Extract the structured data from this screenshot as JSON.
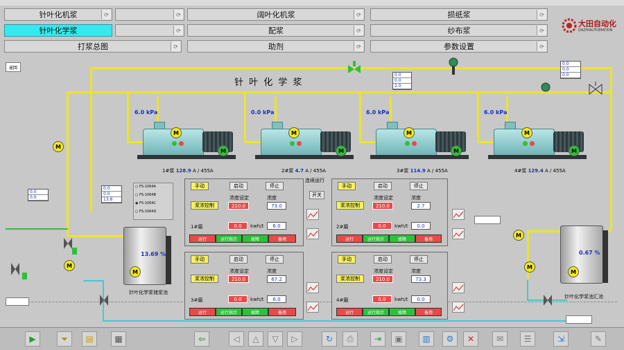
{
  "nav": {
    "row1": [
      "针叶化机浆",
      "阔叶化机浆",
      "损纸浆"
    ],
    "row2": [
      "针叶化学浆",
      "配浆",
      "纱布浆"
    ],
    "row3": [
      "打浆总图",
      "助剂",
      "参数设置"
    ]
  },
  "logo": {
    "name": "大田自动化",
    "sub": "DAZHIAUTOMATION"
  },
  "page_tag": "返回",
  "title": "针 叶 化 学 浆",
  "pumps": [
    {
      "label": "1#浆",
      "current": "128.9",
      "unit": "A / 455A",
      "pressure": "6.0"
    },
    {
      "label": "2#浆",
      "current": "4.7",
      "unit": "A / 455A",
      "pressure": "0.0"
    },
    {
      "label": "3#浆",
      "current": "114.9",
      "unit": "A / 455A",
      "pressure": "6.0"
    },
    {
      "label": "4#浆",
      "current": "129.4",
      "unit": "A / 455A",
      "pressure": "6.0"
    }
  ],
  "pressure_unit": "kPa",
  "top_table": [
    "0.0",
    "0.0",
    "2.0"
  ],
  "right_table": [
    "0.0",
    "0.0",
    "0.0"
  ],
  "left_table": [
    "0.0",
    "0.0"
  ],
  "mid_table": [
    "0.0",
    "0.0",
    "13.8"
  ],
  "radio_options": [
    "FS-1064A",
    "FS-1064B",
    "FS-1064C",
    "FS-1064D"
  ],
  "side_label": "连续运行",
  "side_btn": "开关",
  "panels": [
    {
      "btn_a": "手动",
      "btn_b": "启动",
      "btn_c": "停止",
      "name": "浆浓控制",
      "sp_label": "浓度设定",
      "sp": "210.0",
      "pv_label": "浓度",
      "pv": "73.0",
      "flow_label": "1#磨",
      "flow_a": "0.0",
      "flow_b": "6.0",
      "flow_unit": "kwh/t",
      "statuses": [
        "运行",
        "运行指示",
        "故障",
        "备用"
      ]
    },
    {
      "btn_a": "手动",
      "btn_b": "启动",
      "btn_c": "停止",
      "name": "浆浓控制",
      "sp_label": "浓度设定",
      "sp": "210.0",
      "pv_label": "浓度",
      "pv": "2.7",
      "flow_label": "2#磨",
      "flow_a": "0.0",
      "flow_b": "0.0",
      "flow_unit": "kwh/t",
      "statuses": [
        "运行",
        "运行指示",
        "故障",
        "备用"
      ]
    },
    {
      "btn_a": "手动",
      "btn_b": "启动",
      "btn_c": "停止",
      "name": "浆浓控制",
      "sp_label": "浓度设定",
      "sp": "210.0",
      "pv_label": "浓度",
      "pv": "67.2",
      "flow_label": "3#磨",
      "flow_a": "0.0",
      "flow_b": "6.0",
      "flow_unit": "kwh/t",
      "statuses": [
        "运行",
        "运行指示",
        "故障",
        "备用"
      ]
    },
    {
      "btn_a": "手动",
      "btn_b": "启动",
      "btn_c": "停止",
      "name": "浆浓控制",
      "sp_label": "浓度设定",
      "sp": "210.0",
      "pv_label": "浓度",
      "pv": "73.3",
      "flow_label": "4#磨",
      "flow_a": "0.0",
      "flow_b": "0.0",
      "flow_unit": "kwh/t",
      "statuses": [
        "运行",
        "运行指示",
        "故障",
        "备用"
      ]
    }
  ],
  "tank_left": {
    "value": "13.69",
    "unit": "%",
    "label": "针叶化学浆储浆池"
  },
  "tank_right": {
    "value": "0.67",
    "unit": "%",
    "label": "针叶化学浆池汇池"
  },
  "colors": {
    "pipe": "#ede42a",
    "water": "#43c8d6",
    "accent": "#37e8ef",
    "alarm": "#e84a4a",
    "run": "#2fbf3a"
  },
  "toolbar_icons": [
    "play-icon",
    "filter-icon",
    "folder-icon",
    "save-icon",
    "back-icon",
    "up-icon",
    "down-icon",
    "forward-icon",
    "refresh-icon",
    "print-icon",
    "export-icon",
    "chart-icon",
    "close-icon",
    "settings-icon",
    "mail-icon",
    "exit-icon"
  ]
}
